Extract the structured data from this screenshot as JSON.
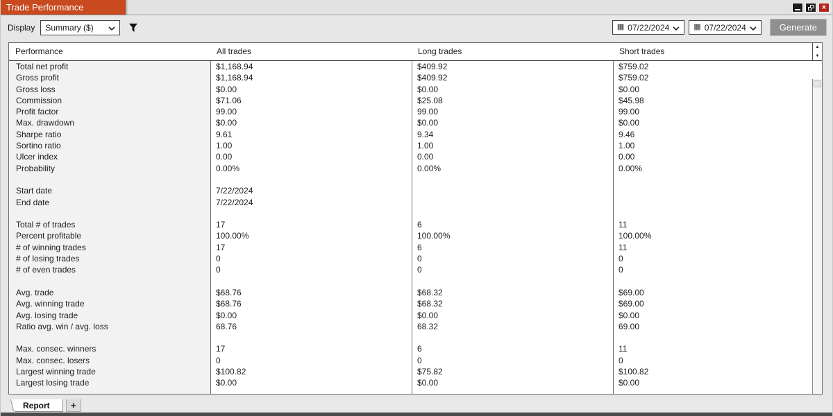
{
  "window": {
    "title": "Trade Performance",
    "controls": {
      "close_glyph": "×"
    }
  },
  "colors": {
    "accent_orange": "#c84a1e",
    "close_red": "#b2241c",
    "button_gray": "#8f8f8f",
    "label_column_bg": "#f2f2f2"
  },
  "toolbar": {
    "display_label": "Display",
    "display_value": "Summary ($)",
    "filter_icon": "funnel",
    "calendar_icon": "▦",
    "date_from": "07/22/2024",
    "date_to": "07/22/2024",
    "generate_label": "Generate"
  },
  "table": {
    "columns": [
      "Performance",
      "All trades",
      "Long trades",
      "Short trades"
    ],
    "scrollbar": {
      "up_icon": "▲",
      "down_icon": "▼"
    },
    "rows": [
      {
        "label": "Total net profit",
        "all": "$1,168.94",
        "long": "$409.92",
        "short": "$759.02"
      },
      {
        "label": "Gross profit",
        "all": "$1,168.94",
        "long": "$409.92",
        "short": "$759.02"
      },
      {
        "label": "Gross loss",
        "all": "$0.00",
        "long": "$0.00",
        "short": "$0.00"
      },
      {
        "label": "Commission",
        "all": "$71.06",
        "long": "$25.08",
        "short": "$45.98"
      },
      {
        "label": "Profit factor",
        "all": "99.00",
        "long": "99.00",
        "short": "99.00"
      },
      {
        "label": "Max. drawdown",
        "all": "$0.00",
        "long": "$0.00",
        "short": "$0.00"
      },
      {
        "label": "Sharpe ratio",
        "all": "9.61",
        "long": "9.34",
        "short": "9.46"
      },
      {
        "label": "Sortino ratio",
        "all": "1.00",
        "long": "1.00",
        "short": "1.00"
      },
      {
        "label": "Ulcer index",
        "all": "0.00",
        "long": "0.00",
        "short": "0.00"
      },
      {
        "label": "Probability",
        "all": "0.00%",
        "long": "0.00%",
        "short": "0.00%"
      },
      {
        "label": "",
        "all": "",
        "long": "",
        "short": ""
      },
      {
        "label": "Start date",
        "all": "7/22/2024",
        "long": "",
        "short": ""
      },
      {
        "label": "End date",
        "all": "7/22/2024",
        "long": "",
        "short": ""
      },
      {
        "label": "",
        "all": "",
        "long": "",
        "short": ""
      },
      {
        "label": "Total # of trades",
        "all": "17",
        "long": "6",
        "short": "11"
      },
      {
        "label": "Percent profitable",
        "all": "100.00%",
        "long": "100.00%",
        "short": "100.00%"
      },
      {
        "label": "# of winning trades",
        "all": "17",
        "long": "6",
        "short": "11"
      },
      {
        "label": "# of losing trades",
        "all": "0",
        "long": "0",
        "short": "0"
      },
      {
        "label": "# of even trades",
        "all": "0",
        "long": "0",
        "short": "0"
      },
      {
        "label": "",
        "all": "",
        "long": "",
        "short": ""
      },
      {
        "label": "Avg. trade",
        "all": "$68.76",
        "long": "$68.32",
        "short": "$69.00"
      },
      {
        "label": "Avg. winning trade",
        "all": "$68.76",
        "long": "$68.32",
        "short": "$69.00"
      },
      {
        "label": "Avg. losing trade",
        "all": "$0.00",
        "long": "$0.00",
        "short": "$0.00"
      },
      {
        "label": "Ratio avg. win / avg. loss",
        "all": "68.76",
        "long": "68.32",
        "short": "69.00"
      },
      {
        "label": "",
        "all": "",
        "long": "",
        "short": ""
      },
      {
        "label": "Max. consec. winners",
        "all": "17",
        "long": "6",
        "short": "11"
      },
      {
        "label": "Max. consec. losers",
        "all": "0",
        "long": "0",
        "short": "0"
      },
      {
        "label": "Largest winning trade",
        "all": "$100.82",
        "long": "$75.82",
        "short": "$100.82"
      },
      {
        "label": "Largest losing trade",
        "all": "$0.00",
        "long": "$0.00",
        "short": "$0.00"
      }
    ]
  },
  "tabs": {
    "report_label": "Report",
    "add_label": "+"
  }
}
